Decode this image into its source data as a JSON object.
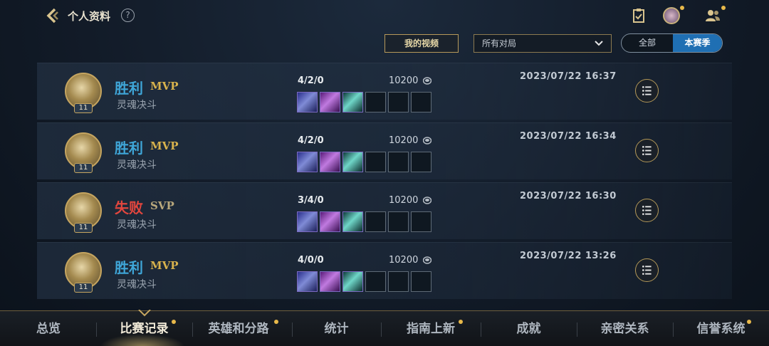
{
  "header": {
    "title": "个人资料",
    "help_symbol": "?"
  },
  "toolbar": {
    "video_button": "我的视频",
    "filter_value": "所有对局",
    "toggle_all": "全部",
    "toggle_season": "本赛季"
  },
  "matches": [
    {
      "result": "胜利",
      "outcome": "win",
      "badge": "MVP",
      "mode": "灵魂决斗",
      "kda": "4/2/0",
      "gold": "10200",
      "time": "2023/07/22 16:37",
      "hero_level": "11"
    },
    {
      "result": "胜利",
      "outcome": "win",
      "badge": "MVP",
      "mode": "灵魂决斗",
      "kda": "4/2/0",
      "gold": "10200",
      "time": "2023/07/22 16:34",
      "hero_level": "11"
    },
    {
      "result": "失败",
      "outcome": "lose",
      "badge": "SVP",
      "mode": "灵魂决斗",
      "kda": "3/4/0",
      "gold": "10200",
      "time": "2023/07/22 16:30",
      "hero_level": "11"
    },
    {
      "result": "胜利",
      "outcome": "win",
      "badge": "MVP",
      "mode": "灵魂决斗",
      "kda": "4/0/0",
      "gold": "10200",
      "time": "2023/07/22 13:26",
      "hero_level": "11"
    }
  ],
  "nav": {
    "items": [
      "总览",
      "比赛记录",
      "英雄和分路",
      "统计",
      "指南上新",
      "成就",
      "亲密关系",
      "信誉系统"
    ],
    "active": "比赛记录"
  },
  "colors": {
    "win": "#3fa6d8",
    "lose": "#e2463e",
    "mvp": "#d8b24d",
    "accent_gold": "#c5a560",
    "toggle_active": "#1f6fb3"
  },
  "icons": {
    "back": "chevron-left-icon",
    "help": "question-icon",
    "task": "clipboard-check-icon",
    "profile": "avatar-icon",
    "friends": "friends-icon",
    "gold": "coin-icon",
    "detail": "list-icon"
  }
}
